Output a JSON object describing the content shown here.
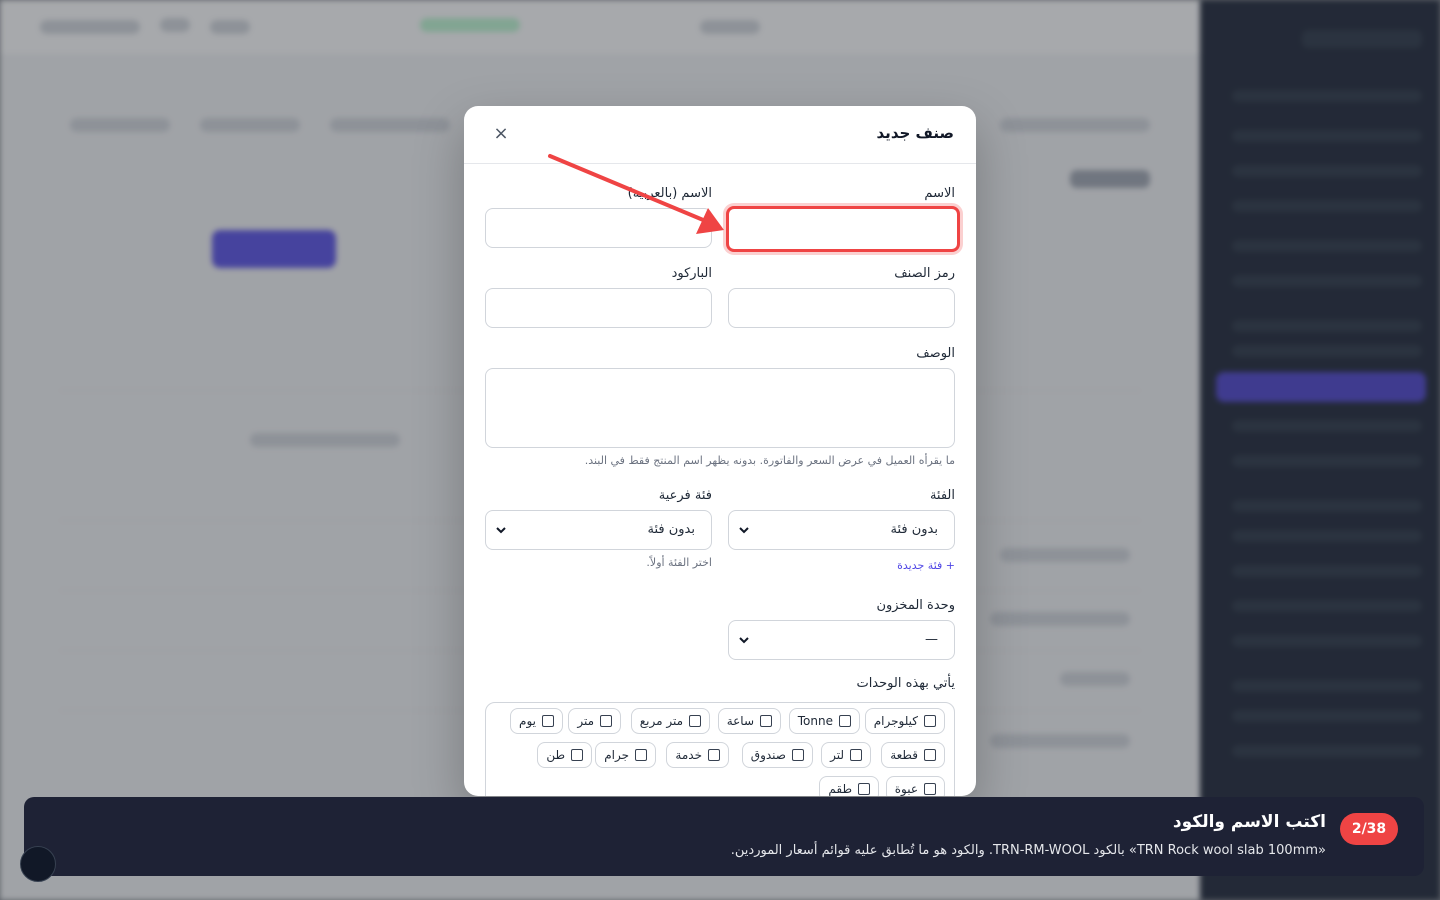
{
  "modal": {
    "title": "صنف جديد",
    "close_symbol": "×",
    "name_label": "الاسم",
    "name_value": "",
    "name_ar_label": "الاسم (بالعربية)",
    "name_ar_value": "",
    "sku_label": "رمز الصنف",
    "barcode_label": "الباركود",
    "description_label": "الوصف",
    "description_hint": "ما يقرأه العميل في عرض السعر والفاتورة. بدونه يظهر اسم المنتج فقط في البند.",
    "category_label": "الفئة",
    "category_value": "بدون فئة",
    "new_category_link": "+ فئة جديدة",
    "subcategory_label": "فئة فرعية",
    "subcategory_value": "بدون فئة",
    "subcategory_hint": "اختر الفئة أولاً.",
    "stock_unit_label": "وحدة المخزون",
    "stock_unit_value": "—",
    "units_label": "يأتي بهذه الوحدات",
    "units": [
      "كيلوجرام",
      "Tonne",
      "ساعة",
      "متر مربع",
      "متر",
      "يوم",
      "قطعة",
      "لتر",
      "صندوق",
      "خدمة",
      "جرام",
      "طن",
      "عبوة",
      "طقم"
    ]
  },
  "tour": {
    "step": "2/38",
    "title": "اكتب الاسم والكود",
    "description": "«TRN Rock wool slab 100mm» بالكود TRN-RM-WOOL. والكود هو ما تُطابق عليه قوائم أسعار الموردين."
  },
  "icons": {
    "close": "close-icon",
    "chevron": "chevron-down-icon",
    "arrow": "annotation-arrow-icon"
  },
  "colors": {
    "accent": "#4f46e5",
    "highlight": "#ef4444",
    "tour_bg": "#1e2235"
  }
}
